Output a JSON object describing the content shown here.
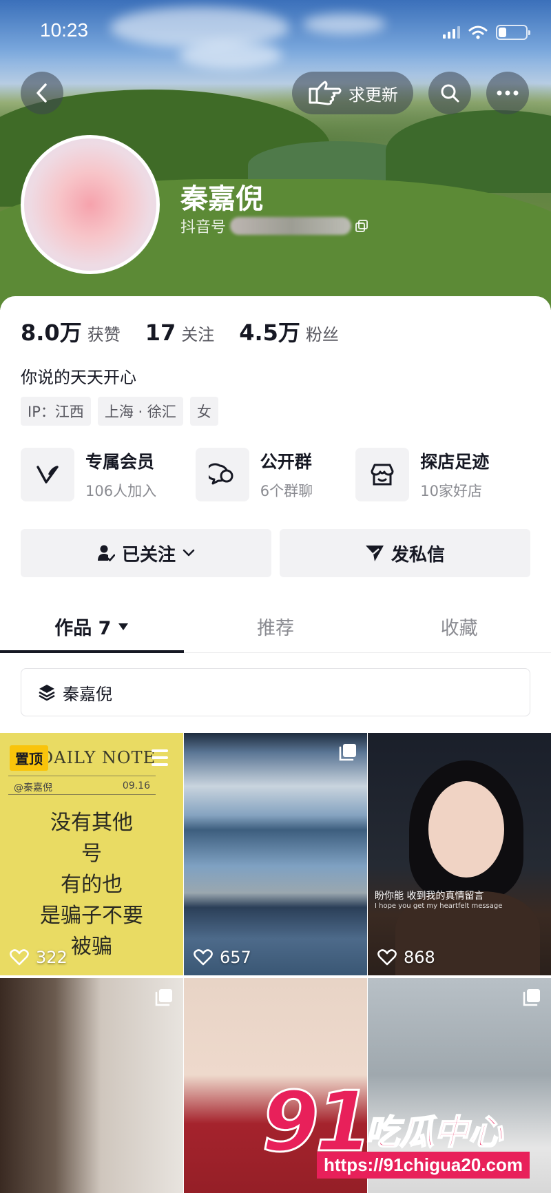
{
  "status_bar": {
    "time": "10:23"
  },
  "header": {
    "request_update_label": "求更新",
    "name": "秦嘉倪",
    "douyin_id_prefix": "抖音号"
  },
  "stats": [
    {
      "value": "8.0万",
      "label": "获赞"
    },
    {
      "value": "17",
      "label": "关注"
    },
    {
      "value": "4.5万",
      "label": "粉丝"
    }
  ],
  "bio": "你说的天天开心",
  "tags": [
    "IP：江西",
    "上海 · 徐汇",
    "女"
  ],
  "features": [
    {
      "icon": "vip-v-icon",
      "title": "专属会员",
      "subtitle": "106人加入"
    },
    {
      "icon": "group-chat-icon",
      "title": "公开群",
      "subtitle": "6个群聊"
    },
    {
      "icon": "store-icon",
      "title": "探店足迹",
      "subtitle": "10家好店"
    }
  ],
  "actions": {
    "following_label": "已关注",
    "message_label": "发私信"
  },
  "tabs": [
    {
      "label": "作品 7",
      "active": true
    },
    {
      "label": "推荐",
      "active": false
    },
    {
      "label": "收藏",
      "active": false
    }
  ],
  "collection": {
    "label": "秦嘉倪"
  },
  "videos": [
    {
      "pinned_label": "置顶",
      "likes": "322",
      "note_header": "DAILY NOTE",
      "note_author": "@秦嘉倪",
      "note_date": "09.16",
      "text_lines": [
        "没有其他",
        "号",
        "有的也",
        "是骗子不要",
        "被骗"
      ]
    },
    {
      "likes": "657"
    },
    {
      "likes": "868",
      "caption_cn": "盼你能 收到我的真情留言",
      "caption_en": "I hope you get my heartfelt message"
    },
    {
      "likes": ""
    },
    {
      "likes": ""
    },
    {
      "likes": ""
    }
  ],
  "watermark": {
    "number": "91",
    "text": "吃瓜中心",
    "url": "https://91chigua20.com"
  },
  "colors": {
    "accent_pink": "#e8205a",
    "pin_yellow": "#f9c40b",
    "text_primary": "#161823"
  }
}
